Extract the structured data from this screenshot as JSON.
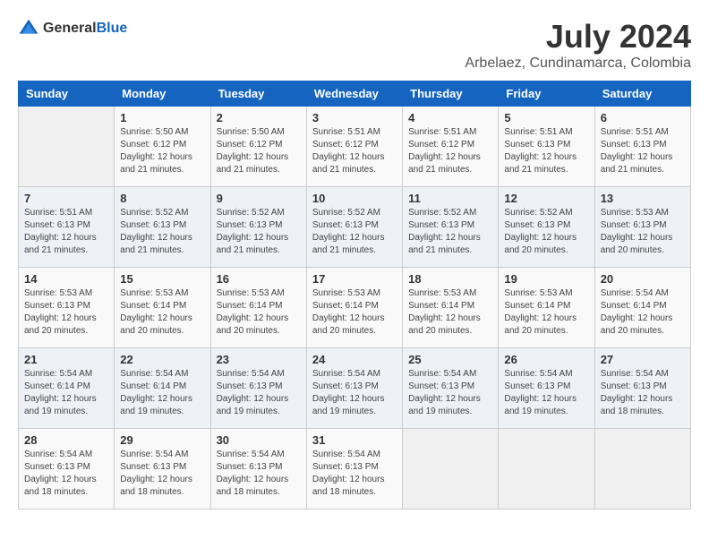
{
  "header": {
    "logo_general": "General",
    "logo_blue": "Blue",
    "month_year": "July 2024",
    "location": "Arbelaez, Cundinamarca, Colombia"
  },
  "weekdays": [
    "Sunday",
    "Monday",
    "Tuesday",
    "Wednesday",
    "Thursday",
    "Friday",
    "Saturday"
  ],
  "weeks": [
    [
      {
        "day": "",
        "sunrise": "",
        "sunset": "",
        "daylight": ""
      },
      {
        "day": "1",
        "sunrise": "Sunrise: 5:50 AM",
        "sunset": "Sunset: 6:12 PM",
        "daylight": "Daylight: 12 hours and 21 minutes."
      },
      {
        "day": "2",
        "sunrise": "Sunrise: 5:50 AM",
        "sunset": "Sunset: 6:12 PM",
        "daylight": "Daylight: 12 hours and 21 minutes."
      },
      {
        "day": "3",
        "sunrise": "Sunrise: 5:51 AM",
        "sunset": "Sunset: 6:12 PM",
        "daylight": "Daylight: 12 hours and 21 minutes."
      },
      {
        "day": "4",
        "sunrise": "Sunrise: 5:51 AM",
        "sunset": "Sunset: 6:12 PM",
        "daylight": "Daylight: 12 hours and 21 minutes."
      },
      {
        "day": "5",
        "sunrise": "Sunrise: 5:51 AM",
        "sunset": "Sunset: 6:13 PM",
        "daylight": "Daylight: 12 hours and 21 minutes."
      },
      {
        "day": "6",
        "sunrise": "Sunrise: 5:51 AM",
        "sunset": "Sunset: 6:13 PM",
        "daylight": "Daylight: 12 hours and 21 minutes."
      }
    ],
    [
      {
        "day": "7",
        "sunrise": "Sunrise: 5:51 AM",
        "sunset": "Sunset: 6:13 PM",
        "daylight": "Daylight: 12 hours and 21 minutes."
      },
      {
        "day": "8",
        "sunrise": "Sunrise: 5:52 AM",
        "sunset": "Sunset: 6:13 PM",
        "daylight": "Daylight: 12 hours and 21 minutes."
      },
      {
        "day": "9",
        "sunrise": "Sunrise: 5:52 AM",
        "sunset": "Sunset: 6:13 PM",
        "daylight": "Daylight: 12 hours and 21 minutes."
      },
      {
        "day": "10",
        "sunrise": "Sunrise: 5:52 AM",
        "sunset": "Sunset: 6:13 PM",
        "daylight": "Daylight: 12 hours and 21 minutes."
      },
      {
        "day": "11",
        "sunrise": "Sunrise: 5:52 AM",
        "sunset": "Sunset: 6:13 PM",
        "daylight": "Daylight: 12 hours and 21 minutes."
      },
      {
        "day": "12",
        "sunrise": "Sunrise: 5:52 AM",
        "sunset": "Sunset: 6:13 PM",
        "daylight": "Daylight: 12 hours and 20 minutes."
      },
      {
        "day": "13",
        "sunrise": "Sunrise: 5:53 AM",
        "sunset": "Sunset: 6:13 PM",
        "daylight": "Daylight: 12 hours and 20 minutes."
      }
    ],
    [
      {
        "day": "14",
        "sunrise": "Sunrise: 5:53 AM",
        "sunset": "Sunset: 6:13 PM",
        "daylight": "Daylight: 12 hours and 20 minutes."
      },
      {
        "day": "15",
        "sunrise": "Sunrise: 5:53 AM",
        "sunset": "Sunset: 6:14 PM",
        "daylight": "Daylight: 12 hours and 20 minutes."
      },
      {
        "day": "16",
        "sunrise": "Sunrise: 5:53 AM",
        "sunset": "Sunset: 6:14 PM",
        "daylight": "Daylight: 12 hours and 20 minutes."
      },
      {
        "day": "17",
        "sunrise": "Sunrise: 5:53 AM",
        "sunset": "Sunset: 6:14 PM",
        "daylight": "Daylight: 12 hours and 20 minutes."
      },
      {
        "day": "18",
        "sunrise": "Sunrise: 5:53 AM",
        "sunset": "Sunset: 6:14 PM",
        "daylight": "Daylight: 12 hours and 20 minutes."
      },
      {
        "day": "19",
        "sunrise": "Sunrise: 5:53 AM",
        "sunset": "Sunset: 6:14 PM",
        "daylight": "Daylight: 12 hours and 20 minutes."
      },
      {
        "day": "20",
        "sunrise": "Sunrise: 5:54 AM",
        "sunset": "Sunset: 6:14 PM",
        "daylight": "Daylight: 12 hours and 20 minutes."
      }
    ],
    [
      {
        "day": "21",
        "sunrise": "Sunrise: 5:54 AM",
        "sunset": "Sunset: 6:14 PM",
        "daylight": "Daylight: 12 hours and 19 minutes."
      },
      {
        "day": "22",
        "sunrise": "Sunrise: 5:54 AM",
        "sunset": "Sunset: 6:14 PM",
        "daylight": "Daylight: 12 hours and 19 minutes."
      },
      {
        "day": "23",
        "sunrise": "Sunrise: 5:54 AM",
        "sunset": "Sunset: 6:13 PM",
        "daylight": "Daylight: 12 hours and 19 minutes."
      },
      {
        "day": "24",
        "sunrise": "Sunrise: 5:54 AM",
        "sunset": "Sunset: 6:13 PM",
        "daylight": "Daylight: 12 hours and 19 minutes."
      },
      {
        "day": "25",
        "sunrise": "Sunrise: 5:54 AM",
        "sunset": "Sunset: 6:13 PM",
        "daylight": "Daylight: 12 hours and 19 minutes."
      },
      {
        "day": "26",
        "sunrise": "Sunrise: 5:54 AM",
        "sunset": "Sunset: 6:13 PM",
        "daylight": "Daylight: 12 hours and 19 minutes."
      },
      {
        "day": "27",
        "sunrise": "Sunrise: 5:54 AM",
        "sunset": "Sunset: 6:13 PM",
        "daylight": "Daylight: 12 hours and 18 minutes."
      }
    ],
    [
      {
        "day": "28",
        "sunrise": "Sunrise: 5:54 AM",
        "sunset": "Sunset: 6:13 PM",
        "daylight": "Daylight: 12 hours and 18 minutes."
      },
      {
        "day": "29",
        "sunrise": "Sunrise: 5:54 AM",
        "sunset": "Sunset: 6:13 PM",
        "daylight": "Daylight: 12 hours and 18 minutes."
      },
      {
        "day": "30",
        "sunrise": "Sunrise: 5:54 AM",
        "sunset": "Sunset: 6:13 PM",
        "daylight": "Daylight: 12 hours and 18 minutes."
      },
      {
        "day": "31",
        "sunrise": "Sunrise: 5:54 AM",
        "sunset": "Sunset: 6:13 PM",
        "daylight": "Daylight: 12 hours and 18 minutes."
      },
      {
        "day": "",
        "sunrise": "",
        "sunset": "",
        "daylight": ""
      },
      {
        "day": "",
        "sunrise": "",
        "sunset": "",
        "daylight": ""
      },
      {
        "day": "",
        "sunrise": "",
        "sunset": "",
        "daylight": ""
      }
    ]
  ]
}
